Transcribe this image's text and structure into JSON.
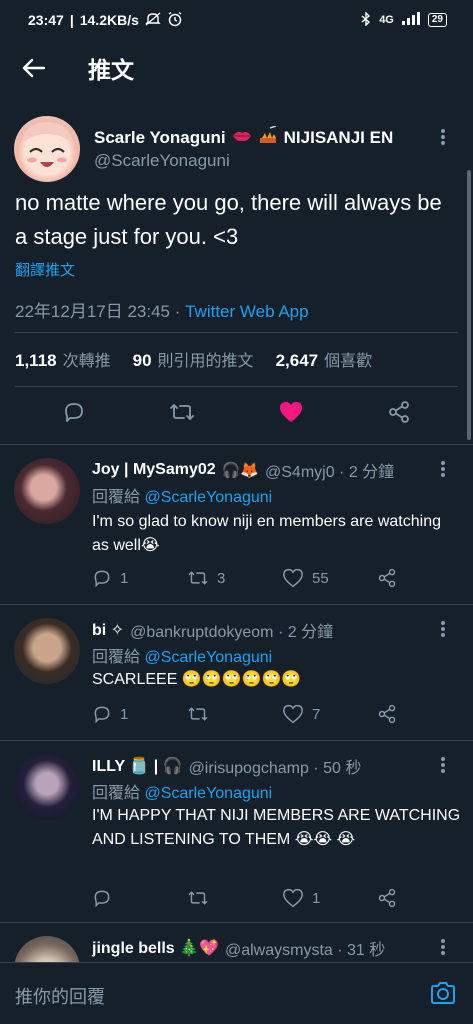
{
  "status_bar": {
    "time": "23:47",
    "speed": "14.2KB/s",
    "network": "4G",
    "battery": "29"
  },
  "app_bar": {
    "title": "推文"
  },
  "main_tweet": {
    "display_name": "Scarle Yonaguni",
    "name_suffix": "NIJISANJI EN",
    "handle": "@ScarleYonaguni",
    "text": "no matte where you go, there will always be a stage just for  you. <3",
    "translate_label": "翻譯推文",
    "timestamp": "22年12月17日 23:45 · ",
    "source": "Twitter Web App",
    "stats": {
      "retweets_count": "1,118",
      "retweets_label": "次轉推",
      "quotes_count": "90",
      "quotes_label": "則引用的推文",
      "likes_count": "2,647",
      "likes_label": "個喜歡"
    },
    "liked": true
  },
  "replies": [
    {
      "name": "Joy | MySamy02",
      "handle": "@S4myj0 · 2 分鐘",
      "reply_prefix": "回覆給",
      "reply_to": "@ScarleYonaguni",
      "text": "I'm so glad to know niji en members are watching as well😭",
      "reply_count": "1",
      "retweet_count": "3",
      "like_count": "55"
    },
    {
      "name": "bi ✧",
      "handle": "@bankruptdokyeom · 2 分鐘",
      "reply_prefix": "回覆給",
      "reply_to": "@ScarleYonaguni",
      "text": "SCARLEEE 🙄🙄🙄🙄🙄🙄",
      "reply_count": "1",
      "retweet_count": "",
      "like_count": "7"
    },
    {
      "name": "ILLY 🫙 | 🎧",
      "handle": "@irisupogchamp · 50 秒",
      "reply_prefix": "回覆給",
      "reply_to": "@ScarleYonaguni",
      "text": "I'M HAPPY THAT NIJI MEMBERS ARE WATCHING AND LISTENING TO THEM 😭😭 😭",
      "reply_count": "",
      "retweet_count": "",
      "like_count": "1"
    },
    {
      "name": "jingle bells 🎄💖",
      "handle": "@alwaysmysta · 31 秒",
      "reply_prefix": "",
      "reply_to": "",
      "text": "",
      "reply_count": "",
      "retweet_count": "",
      "like_count": ""
    }
  ],
  "composer": {
    "placeholder": "推你的回覆"
  },
  "colors": {
    "background": "#15202b",
    "accent": "#1da1f2",
    "like": "#f91880",
    "muted": "#8899a6"
  }
}
